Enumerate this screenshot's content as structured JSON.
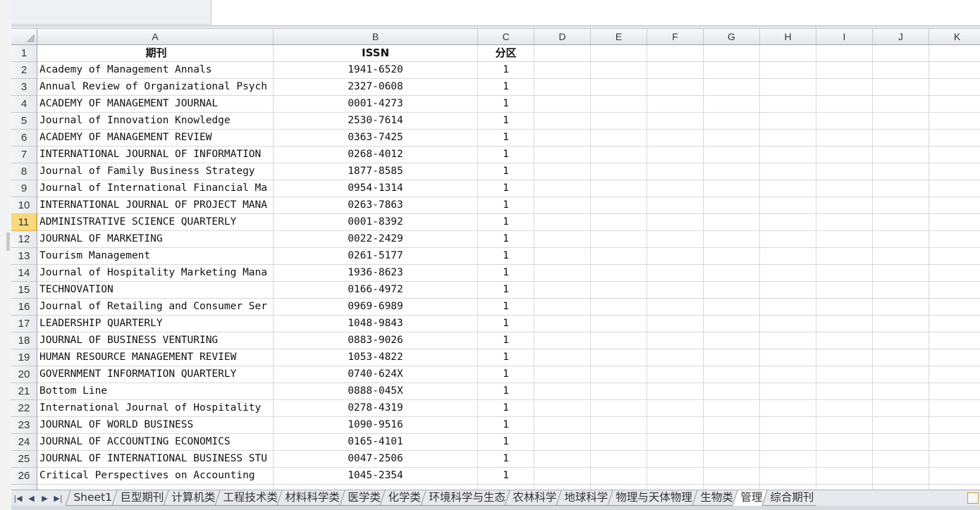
{
  "columns": [
    "A",
    "B",
    "C",
    "D",
    "E",
    "F",
    "G",
    "H",
    "I",
    "J",
    "K"
  ],
  "header_row": {
    "row": "1",
    "a": "期刊",
    "b": "ISSN",
    "c": "分区"
  },
  "rows": [
    {
      "row": "2",
      "a": "Academy of Management Annals",
      "b": "1941-6520",
      "c": "1"
    },
    {
      "row": "3",
      "a": "Annual Review of Organizational Psych",
      "b": "2327-0608",
      "c": "1"
    },
    {
      "row": "4",
      "a": "ACADEMY OF MANAGEMENT JOURNAL",
      "b": "0001-4273",
      "c": "1"
    },
    {
      "row": "5",
      "a": "Journal of Innovation Knowledge",
      "b": "2530-7614",
      "c": "1"
    },
    {
      "row": "6",
      "a": "ACADEMY OF MANAGEMENT REVIEW",
      "b": "0363-7425",
      "c": "1"
    },
    {
      "row": "7",
      "a": "INTERNATIONAL JOURNAL OF INFORMATION",
      "b": "0268-4012",
      "c": "1"
    },
    {
      "row": "8",
      "a": "Journal of Family Business Strategy",
      "b": "1877-8585",
      "c": "1"
    },
    {
      "row": "9",
      "a": "Journal of International Financial Ma",
      "b": "0954-1314",
      "c": "1"
    },
    {
      "row": "10",
      "a": "INTERNATIONAL JOURNAL OF PROJECT MANA",
      "b": "0263-7863",
      "c": "1"
    },
    {
      "row": "11",
      "a": "ADMINISTRATIVE SCIENCE QUARTERLY",
      "b": "0001-8392",
      "c": "1"
    },
    {
      "row": "12",
      "a": "JOURNAL OF MARKETING",
      "b": "0022-2429",
      "c": "1"
    },
    {
      "row": "13",
      "a": "Tourism Management",
      "b": "0261-5177",
      "c": "1"
    },
    {
      "row": "14",
      "a": "Journal of Hospitality Marketing Mana",
      "b": "1936-8623",
      "c": "1"
    },
    {
      "row": "15",
      "a": "TECHNOVATION",
      "b": "0166-4972",
      "c": "1"
    },
    {
      "row": "16",
      "a": "Journal of Retailing and Consumer Ser",
      "b": "0969-6989",
      "c": "1"
    },
    {
      "row": "17",
      "a": "LEADERSHIP QUARTERLY",
      "b": "1048-9843",
      "c": "1"
    },
    {
      "row": "18",
      "a": "JOURNAL OF BUSINESS VENTURING",
      "b": "0883-9026",
      "c": "1"
    },
    {
      "row": "19",
      "a": "HUMAN RESOURCE MANAGEMENT REVIEW",
      "b": "1053-4822",
      "c": "1"
    },
    {
      "row": "20",
      "a": "GOVERNMENT INFORMATION QUARTERLY",
      "b": "0740-624X",
      "c": "1"
    },
    {
      "row": "21",
      "a": "Bottom Line",
      "b": "0888-045X",
      "c": "1"
    },
    {
      "row": "22",
      "a": "International Journal of Hospitality",
      "b": "0278-4319",
      "c": "1"
    },
    {
      "row": "23",
      "a": "JOURNAL OF WORLD BUSINESS",
      "b": "1090-9516",
      "c": "1"
    },
    {
      "row": "24",
      "a": "JOURNAL OF ACCOUNTING ECONOMICS",
      "b": "0165-4101",
      "c": "1"
    },
    {
      "row": "25",
      "a": "JOURNAL OF INTERNATIONAL BUSINESS STU",
      "b": "0047-2506",
      "c": "1"
    },
    {
      "row": "26",
      "a": "Critical Perspectives on Accounting",
      "b": "1045-2354",
      "c": "1"
    }
  ],
  "selected_row": "11",
  "sheet_tabs": [
    "Sheet1",
    "巨型期刊",
    "计算机类",
    "工程技术类",
    "材料科学类",
    "医学类",
    "化学类",
    "环境科学与生态",
    "农林科学",
    "地球科学",
    "物理与天体物理",
    "生物类",
    "管理",
    "综合期刊"
  ],
  "active_tab": "管理",
  "nav_buttons": [
    "first-sheet",
    "prev-sheet",
    "next-sheet",
    "last-sheet"
  ]
}
